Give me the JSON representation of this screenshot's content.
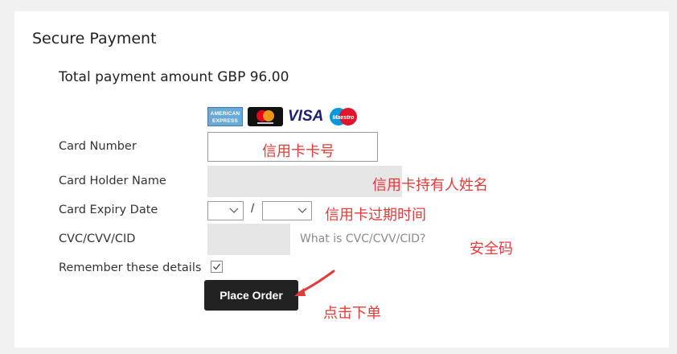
{
  "header": {
    "title": "Secure Payment"
  },
  "payment": {
    "total_label": "Total payment amount GBP 96.00"
  },
  "card_logos": {
    "amex_text_1": "AMERICAN",
    "amex_text_2": "EXPRESS",
    "visa_text": "VISA",
    "maestro_text": "Maestro"
  },
  "form": {
    "card_number_label": "Card Number",
    "card_holder_label": "Card Holder Name",
    "expiry_label": "Card Expiry Date",
    "expiry_separator": "/",
    "cvc_label": "CVC/CVV/CID",
    "cvc_help": "What is CVC/CVV/CID?",
    "remember_label": "Remember these details",
    "remember_checked": true,
    "place_order_label": "Place Order"
  },
  "annotations": {
    "card_number_note": "信用卡卡号",
    "card_holder_note": "信用卡持有人姓名",
    "expiry_note": "信用卡过期时间",
    "cvc_note": "安全码",
    "place_order_note": "点击下单"
  },
  "colors": {
    "annotation": "#e13b3b",
    "button_bg": "#222222",
    "field_grey": "#e6e6e6"
  },
  "icons": {
    "dropdown": "chevron-down-icon",
    "checkbox": "check-icon",
    "pointer": "arrow-icon"
  }
}
